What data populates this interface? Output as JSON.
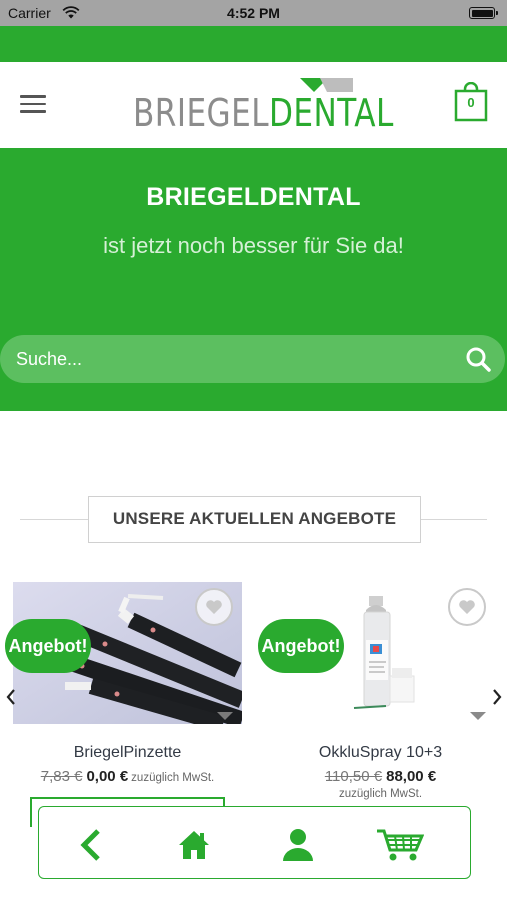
{
  "status_bar": {
    "carrier": "Carrier",
    "time": "4:52 PM"
  },
  "header": {
    "logo": {
      "light": "BRIEGEL",
      "bold": "DENTAL"
    },
    "cart_count": "0"
  },
  "hero": {
    "title": "BRIEGELDENTAL",
    "subtitle": "ist jetzt noch besser für Sie da!",
    "search_placeholder": "Suche..."
  },
  "section": {
    "title": "UNSERE AKTUELLEN ANGEBOTE"
  },
  "products": [
    {
      "name": "BriegelPinzette",
      "badge": "Angebot!",
      "old_price": "7,83 €",
      "price": "0,00 €",
      "vat": "zuzüglich MwSt."
    },
    {
      "name": "OkkluSpray 10+3",
      "badge": "Angebot!",
      "old_price": "110,50 €",
      "price": "88,00 €",
      "vat": "zuzüglich MwSt."
    }
  ],
  "colors": {
    "brand_green": "#2aaa2f",
    "search_green": "#5cbf60",
    "logo_grey": "#8c8c8c",
    "status_bar": "#a4a4a4"
  },
  "icons": {
    "menu": "hamburger-icon",
    "cart": "shopping-bag-icon",
    "search": "search-icon",
    "wishlist": "heart-icon",
    "prev": "chevron-left-icon",
    "next": "chevron-right-icon",
    "nav_back": "back-arrow-icon",
    "nav_home": "home-icon",
    "nav_account": "user-icon",
    "nav_cart": "cart-icon"
  }
}
